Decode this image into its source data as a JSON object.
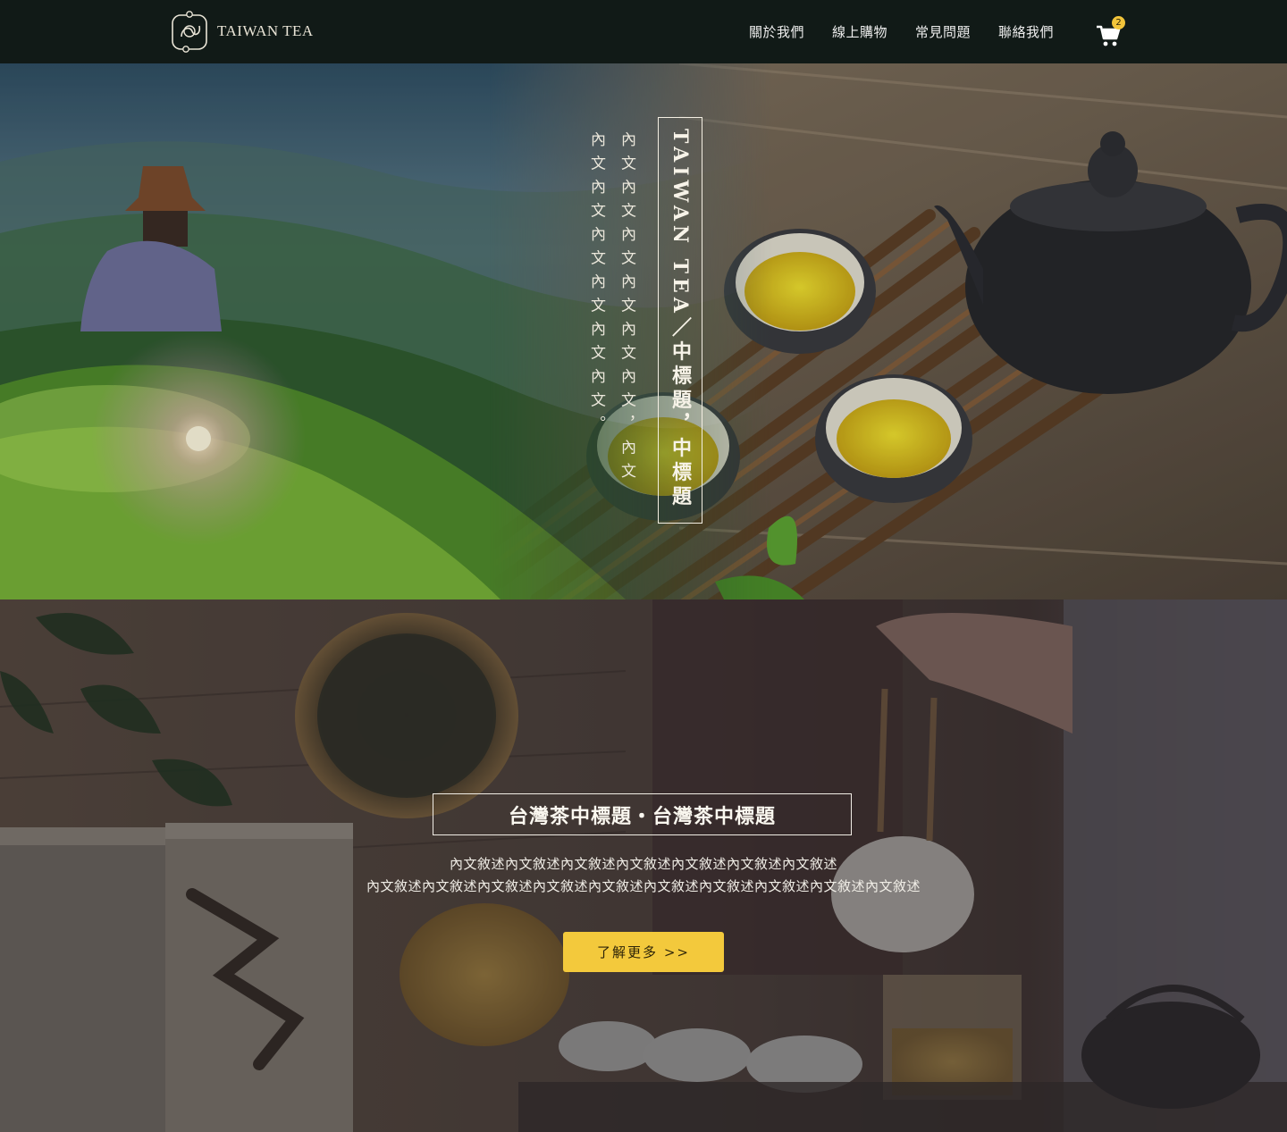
{
  "brand": {
    "name": "TAIWAN TEA",
    "logo_icon": "tea-leaf-swirl-logo"
  },
  "nav": {
    "items": [
      {
        "label": "關於我們"
      },
      {
        "label": "線上購物"
      },
      {
        "label": "常見問題"
      },
      {
        "label": "聯絡我們"
      }
    ],
    "cart": {
      "icon": "shopping-cart-icon",
      "count": "2"
    }
  },
  "hero": {
    "title": "TAIWAN TEA／中標題，中標題",
    "body": "內文內文內文內文內文內文，內文內文內文內文內文內文內文。"
  },
  "feature": {
    "title": "台灣茶中標題・台灣茶中標題",
    "desc_line1": "內文敘述內文敘述內文敘述內文敘述內文敘述內文敘述內文敘述",
    "desc_line2": "內文敘述內文敘述內文敘述內文敘述內文敘述內文敘述內文敘述內文敘述內文敘述內文敘述",
    "button_label": "了解更多 >>"
  },
  "colors": {
    "navbar_bg": "#111a17",
    "accent_yellow": "#f3c93c",
    "text_light": "#f7f3e8"
  }
}
